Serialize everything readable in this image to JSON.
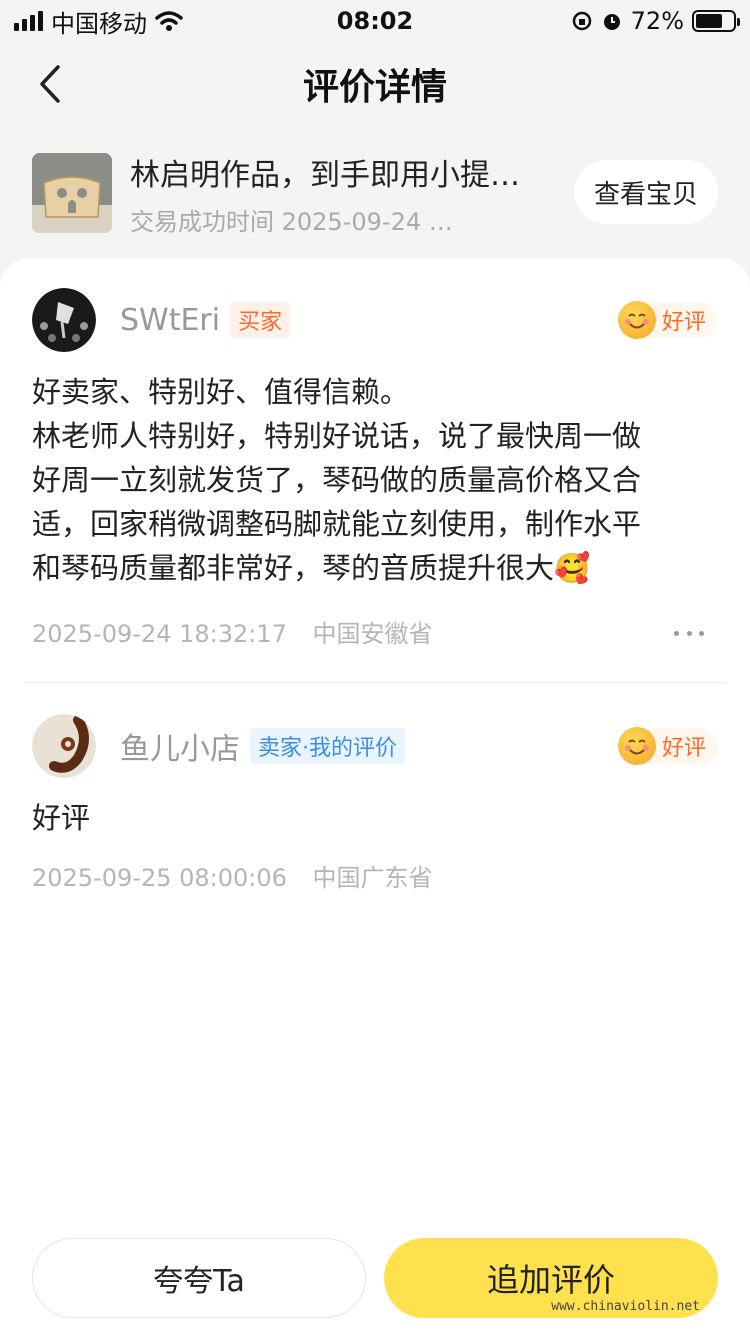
{
  "status_bar": {
    "carrier": "中国移动",
    "time": "08:02",
    "battery_text": "72%",
    "battery_level": 0.72
  },
  "nav": {
    "title": "评价详情"
  },
  "product": {
    "title": "林启明作品，到手即用小提…",
    "subtitle": "交易成功时间 2025-09-24 …",
    "view_button": "查看宝贝"
  },
  "reviews": [
    {
      "user": "SWtEri",
      "tag": "买家",
      "rating": "好评",
      "lines": [
        "好卖家、特别好、值得信赖。",
        "林老师人特别好，特别好说话，说了最快周一做",
        "好周一立刻就发货了，琴码做的质量高价格又合",
        "适，回家稍微调整码脚就能立刻使用，制作水平",
        "和琴码质量都非常好，琴的音质提升很大🥰"
      ],
      "time": "2025-09-24 18:32:17",
      "location": "中国安徽省"
    },
    {
      "user": "鱼儿小店",
      "tag": "卖家·我的评价",
      "rating": "好评",
      "lines": [
        "好评"
      ],
      "time": "2025-09-25 08:00:06",
      "location": "中国广东省"
    }
  ],
  "bottom": {
    "praise_button": "夸夸Ta",
    "add_review_button": "追加评价"
  },
  "watermark": "www.chinaviolin.net",
  "colors": {
    "accent_yellow": "#ffe14d",
    "buyer_tag": "#ff6a2a",
    "seller_tag": "#3a8ee6"
  },
  "icons": {
    "back": "chevron-left-icon",
    "wifi": "wifi-icon",
    "signal": "signal-icon",
    "lock_rotation": "orientation-lock-icon",
    "alarm": "alarm-icon",
    "battery": "battery-icon",
    "more": "more-icon",
    "rating": "smiley-face-icon"
  }
}
